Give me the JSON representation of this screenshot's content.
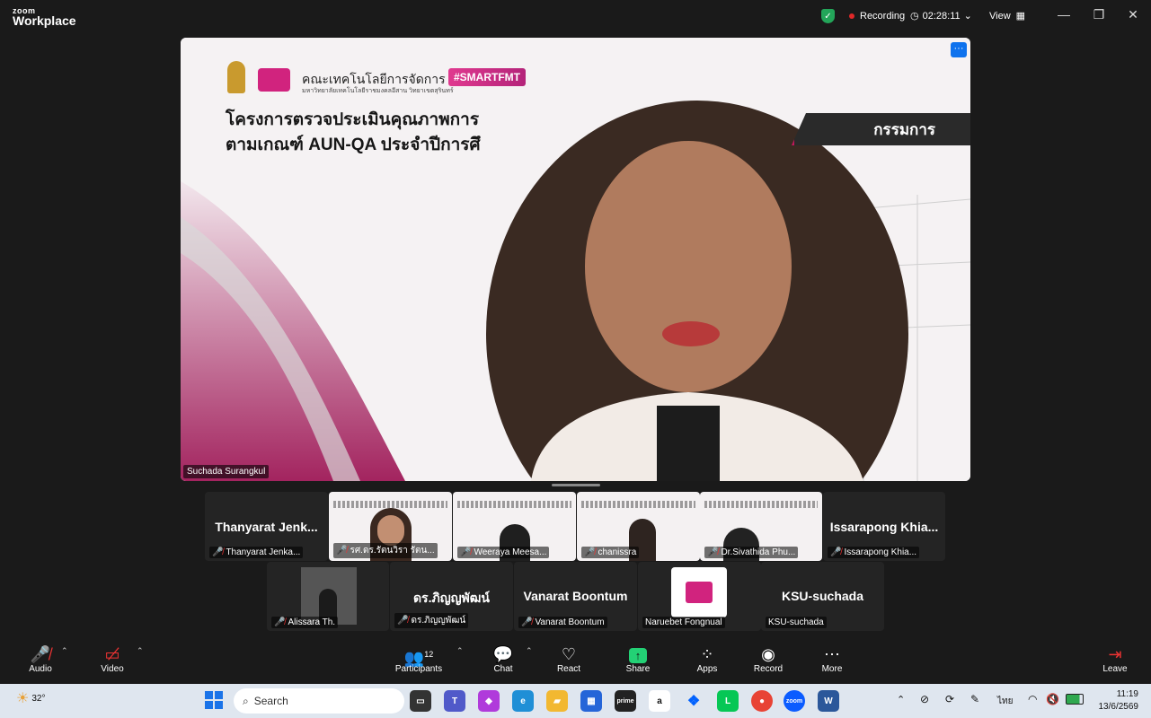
{
  "app": {
    "brand_top": "zoom",
    "brand_main": "Workplace"
  },
  "titlebar": {
    "recording_label": "Recording",
    "timer": "02:28:11",
    "view_label": "View",
    "minimize_icon": "minimize-icon",
    "restore_icon": "restore-icon",
    "close_icon": "close-icon"
  },
  "main_video": {
    "slide_org": "คณะเทคโนโลยีการจัดการ",
    "slide_org_sub": "มหาวิทยาลัยเทคโนโลยีราชมงคลอีสาน วิทยาเขตสุรินทร์",
    "slide_tag": "#SMARTFMT",
    "slide_title_line1": "โครงการตรวจประเมินคุณภาพการ",
    "slide_title_line2": "ตามเกณฑ์ AUN-QA ประจำปีการศึ",
    "slide_role": "กรรมการ",
    "more_label": "···",
    "participant_name": "Suchada Surangkul"
  },
  "gallery_row1": [
    {
      "type": "name",
      "big": "Thanyarat  Jenk...",
      "label": "Thanyarat  Jenka..."
    },
    {
      "type": "video",
      "label": "รศ.ดร.รัตนวิรา รัตน..."
    },
    {
      "type": "video",
      "label": "Weeraya Meesa..."
    },
    {
      "type": "video",
      "label": "chanissra"
    },
    {
      "type": "video",
      "label": "Dr.Sivathida Phu..."
    },
    {
      "type": "name",
      "big": "Issarapong  Khia...",
      "label": "Issarapong  Khia..."
    }
  ],
  "gallery_row2": [
    {
      "type": "video",
      "label": "Alissara Th."
    },
    {
      "type": "name",
      "big": "ดร.ภิญญพัฒน์",
      "label": "ดร.ภิญญพัฒน์"
    },
    {
      "type": "name",
      "big": "Vanarat Boontum",
      "label": "Vanarat Boontum"
    },
    {
      "type": "logo",
      "label": "Naruebet Fongnual"
    },
    {
      "type": "name",
      "big": "KSU-suchada",
      "label": "KSU-suchada"
    }
  ],
  "toolbar": {
    "audio": "Audio",
    "video": "Video",
    "participants": "Participants",
    "participants_count": "12",
    "chat": "Chat",
    "react": "React",
    "share": "Share",
    "apps": "Apps",
    "record": "Record",
    "more": "More",
    "leave": "Leave"
  },
  "taskbar": {
    "weather": "32°",
    "search_placeholder": "Search",
    "language": "ไทย",
    "time": "11:19",
    "date": "13/6/2569"
  },
  "colors": {
    "accent": "#0e72ed",
    "share_green": "#23d175",
    "mic_off_red": "#e33333",
    "brand_pink": "#c2185b"
  }
}
